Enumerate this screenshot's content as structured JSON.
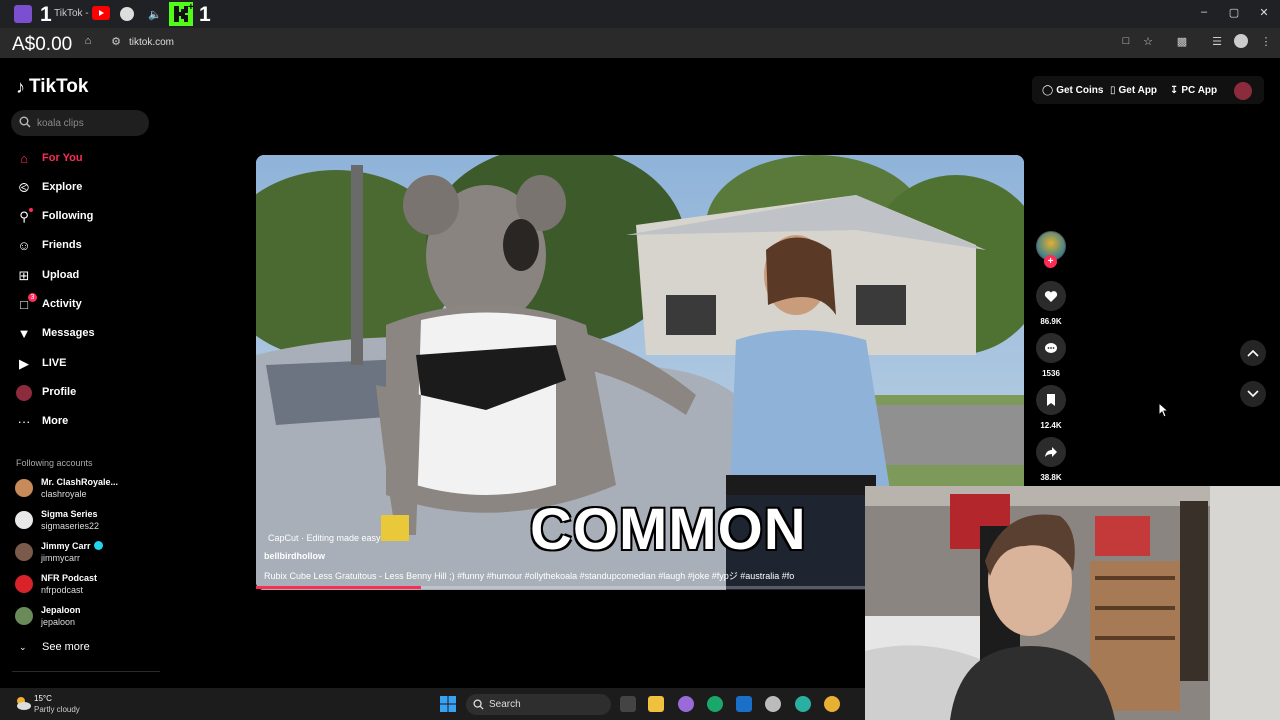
{
  "browser": {
    "tab_title": "TikTok - Ma",
    "overlay_digit_1": "1",
    "overlay_digit_2": "1",
    "overlay_plus": "+",
    "balance": "A$0.00",
    "url": "tiktok.com",
    "window_controls": [
      "–",
      "▢",
      "✕"
    ]
  },
  "tiktok": {
    "logo_text": "TikTok",
    "search": {
      "placeholder": "koala clips"
    },
    "nav": [
      {
        "label": "For You",
        "icon": "home-icon",
        "active": true
      },
      {
        "label": "Explore",
        "icon": "compass-icon"
      },
      {
        "label": "Following",
        "icon": "following-icon",
        "dot": true
      },
      {
        "label": "Friends",
        "icon": "friends-icon"
      },
      {
        "label": "Upload",
        "icon": "upload-icon"
      },
      {
        "label": "Activity",
        "icon": "inbox-icon",
        "badge": "3"
      },
      {
        "label": "Messages",
        "icon": "send-icon"
      },
      {
        "label": "LIVE",
        "icon": "live-icon"
      },
      {
        "label": "Profile",
        "icon": "profile-avatar"
      },
      {
        "label": "More",
        "icon": "more-icon"
      }
    ],
    "following_title": "Following accounts",
    "following": [
      {
        "name": "Mr. ClashRoyale...",
        "handle": "clashroyale",
        "verified": false,
        "color": "#c98a5a"
      },
      {
        "name": "Sigma Series",
        "handle": "sigmaseries22",
        "verified": false,
        "color": "#e8e8e8"
      },
      {
        "name": "Jimmy Carr",
        "handle": "jimmycarr",
        "verified": true,
        "color": "#7a5a4a"
      },
      {
        "name": "NFR Podcast",
        "handle": "nfrpodcast",
        "verified": false,
        "color": "#d8232a"
      },
      {
        "name": "Jepaloon",
        "handle": "jepaloon",
        "verified": false,
        "color": "#6a8a5a"
      }
    ],
    "see_more": "See more",
    "top_buttons": {
      "coins": "Get Coins",
      "app": "Get App",
      "pc": "PC App"
    },
    "video": {
      "caption": "COMMON",
      "capcut": "CapCut · Editing made easy",
      "author": "bellbirdhollow",
      "description": "Rubix Cube Less Gratuitous - Less Benny Hill ;) #funny #humour #ollythekoala #standupcomedian #laugh #joke #fypジ #australia #fo",
      "progress": 0.27
    },
    "rail": {
      "likes": "86.9K",
      "comments": "1536",
      "saves": "12.4K",
      "shares": "38.8K"
    }
  },
  "taskbar": {
    "temp": "15°C",
    "weather": "Partly cloudy",
    "search_label": "Search"
  },
  "colors": {
    "accent": "#fe2c55",
    "verified": "#20d5ec"
  }
}
